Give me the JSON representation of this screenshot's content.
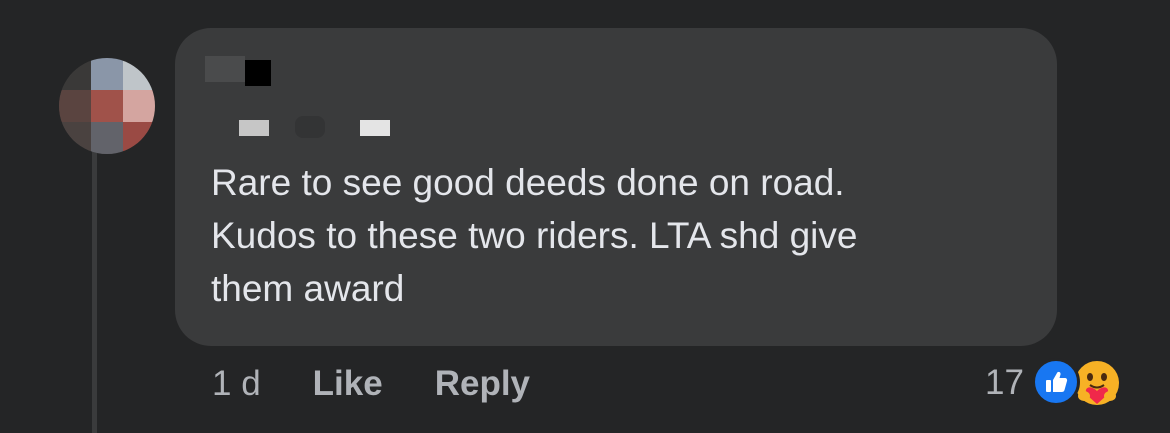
{
  "comment": {
    "text": "Rare to see good deeds done on road.\nKudos to these two riders. LTA shd give\nthem award",
    "timestamp": "1 d",
    "actions": {
      "like_label": "Like",
      "reply_label": "Reply"
    },
    "reactions": {
      "count": "17",
      "types": [
        "like-icon",
        "care-icon"
      ]
    }
  },
  "colors": {
    "background": "#242526",
    "bubble": "#3a3b3c",
    "text": "#e4e6eb",
    "secondary_text": "#b0b3b8",
    "like_blue": "#1877f2",
    "care_yellow": "#f7b125"
  }
}
